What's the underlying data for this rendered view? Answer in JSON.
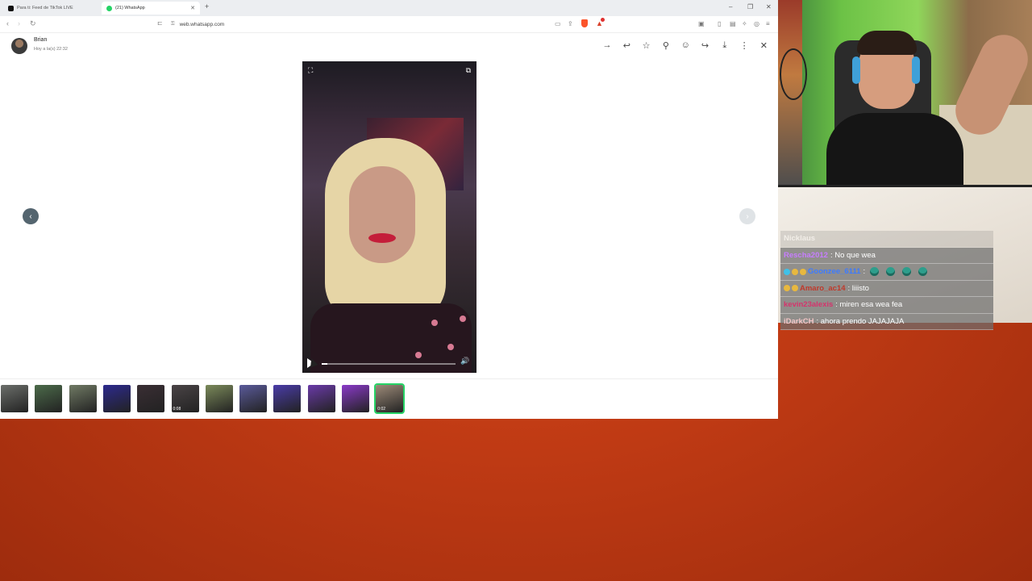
{
  "browser": {
    "tabs": [
      {
        "title": "Para ti: Feed de TikTok LIVE",
        "active": false
      },
      {
        "title": "(21) WhatsApp",
        "active": true
      }
    ],
    "new_tab": "+",
    "window_controls": {
      "minimize": "–",
      "restore": "❐",
      "close": "✕"
    },
    "url": "web.whatsapp.com",
    "brand_color": "#fb542b"
  },
  "viewer": {
    "sender": {
      "name": "Brian",
      "time": "Hoy a la(s) 22:32"
    },
    "actions": [
      {
        "name": "forward-chat-icon",
        "glyph": "→"
      },
      {
        "name": "reply-icon",
        "glyph": "↩"
      },
      {
        "name": "star-icon",
        "glyph": "☆"
      },
      {
        "name": "pin-icon",
        "glyph": "⚲"
      },
      {
        "name": "emoji-icon",
        "glyph": "☺"
      },
      {
        "name": "share-icon",
        "glyph": "↪"
      },
      {
        "name": "download-icon",
        "glyph": "⤓"
      },
      {
        "name": "more-icon",
        "glyph": "⋮"
      },
      {
        "name": "close-icon",
        "glyph": "✕"
      }
    ],
    "video": {
      "progress": 0.04
    },
    "prev_glyph": "‹",
    "next_glyph": "›",
    "thumbnails": [
      {
        "color": "#6b6e6a",
        "duration": ""
      },
      {
        "color": "#4c6b4a",
        "duration": ""
      },
      {
        "color": "#707a64",
        "duration": ""
      },
      {
        "color": "#2d2a8e",
        "duration": ""
      },
      {
        "color": "#3a2e34",
        "duration": ""
      },
      {
        "color": "#4a4446",
        "duration": "0:08"
      },
      {
        "color": "#7b8a5a",
        "duration": ""
      },
      {
        "color": "#5a5a9a",
        "duration": ""
      },
      {
        "color": "#4a3ca8",
        "duration": ""
      },
      {
        "color": "#6a3aa8",
        "duration": ""
      },
      {
        "color": "#8a3ac8",
        "duration": ""
      },
      {
        "color": "#9c8a78",
        "duration": "0:02",
        "selected": true
      }
    ],
    "accent": "#25d366"
  },
  "chat": {
    "messages": [
      {
        "user": "Nicklaus",
        "message": "",
        "user_color": "#ffffff",
        "faded": true,
        "badges": []
      },
      {
        "user": "Rescha2012",
        "message": ": No que wea",
        "user_color": "#c77dff",
        "badges": []
      },
      {
        "user": "Goonzee_6111",
        "message": ":",
        "user_color": "#3d7bff",
        "badges": [
          "#3fc1e8",
          "#e8b83f",
          "#e8b83f"
        ],
        "emotes": 4
      },
      {
        "user": "Amaro_ac14",
        "message": ": liiisto",
        "user_color": "#c0392b",
        "badges": [
          "#e8b83f",
          "#e8b83f"
        ]
      },
      {
        "user": "kevin23alexis",
        "message": ": miren esa wea fea",
        "user_color": "#d6336c",
        "badges": []
      },
      {
        "user": "iDarkCH",
        "message": ": ahora prendo JAJAJAJA",
        "user_color": "#f3c6c6",
        "badges": []
      }
    ]
  }
}
